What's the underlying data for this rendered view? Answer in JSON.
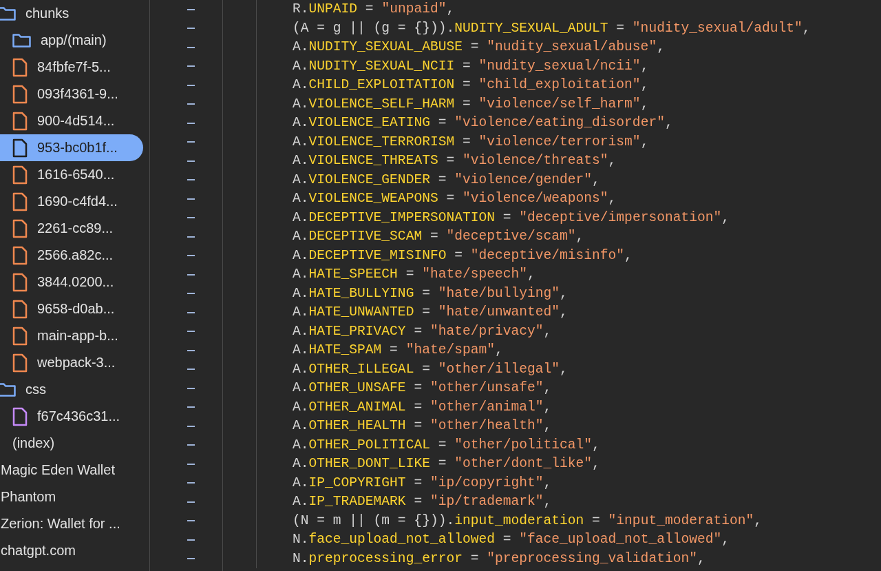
{
  "sidebar": {
    "items": [
      {
        "label": "chunks",
        "kind": "folder",
        "selected": false,
        "children": [
          {
            "label": "app/(main)",
            "kind": "folder",
            "selected": false
          },
          {
            "label": "84fbfe7f-5...",
            "kind": "script",
            "selected": false
          },
          {
            "label": "093f4361-9...",
            "kind": "script",
            "selected": false
          },
          {
            "label": "900-4d514...",
            "kind": "script",
            "selected": false
          },
          {
            "label": "953-bc0b1f...",
            "kind": "script",
            "selected": true
          },
          {
            "label": "1616-6540...",
            "kind": "script",
            "selected": false
          },
          {
            "label": "1690-c4fd4...",
            "kind": "script",
            "selected": false
          },
          {
            "label": "2261-cc89...",
            "kind": "script",
            "selected": false
          },
          {
            "label": "2566.a82c...",
            "kind": "script",
            "selected": false
          },
          {
            "label": "3844.0200...",
            "kind": "script",
            "selected": false
          },
          {
            "label": "9658-d0ab...",
            "kind": "script",
            "selected": false
          },
          {
            "label": "main-app-b...",
            "kind": "script",
            "selected": false
          },
          {
            "label": "webpack-3...",
            "kind": "script",
            "selected": false
          }
        ]
      },
      {
        "label": "css",
        "kind": "folder",
        "selected": false,
        "children": [
          {
            "label": "f67c436c31...",
            "kind": "stylesheet",
            "selected": false
          }
        ]
      },
      {
        "label": "(index)",
        "kind": "document",
        "selected": false
      },
      {
        "label": "Magic Eden Wallet",
        "kind": "frame",
        "selected": false
      },
      {
        "label": "Phantom",
        "kind": "frame",
        "selected": false
      },
      {
        "label": "Zerion: Wallet for ...",
        "kind": "frame",
        "selected": false
      },
      {
        "label": "chatgpt.com",
        "kind": "frame",
        "selected": false
      }
    ]
  },
  "code": {
    "lines": [
      [
        {
          "kind": "plain",
          "text": "R."
        },
        {
          "kind": "prop",
          "text": "UNPAID"
        },
        {
          "kind": "plain",
          "text": " = "
        },
        {
          "kind": "string",
          "text": "\"unpaid\""
        },
        {
          "kind": "plain",
          "text": ","
        }
      ],
      [
        {
          "kind": "plain",
          "text": "(A = g || (g = {}))."
        },
        {
          "kind": "prop",
          "text": "NUDITY_SEXUAL_ADULT"
        },
        {
          "kind": "plain",
          "text": " = "
        },
        {
          "kind": "string",
          "text": "\"nudity_sexual/adult\""
        },
        {
          "kind": "plain",
          "text": ","
        }
      ],
      [
        {
          "kind": "plain",
          "text": "A."
        },
        {
          "kind": "prop",
          "text": "NUDITY_SEXUAL_ABUSE"
        },
        {
          "kind": "plain",
          "text": " = "
        },
        {
          "kind": "string",
          "text": "\"nudity_sexual/abuse\""
        },
        {
          "kind": "plain",
          "text": ","
        }
      ],
      [
        {
          "kind": "plain",
          "text": "A."
        },
        {
          "kind": "prop",
          "text": "NUDITY_SEXUAL_NCII"
        },
        {
          "kind": "plain",
          "text": " = "
        },
        {
          "kind": "string",
          "text": "\"nudity_sexual/ncii\""
        },
        {
          "kind": "plain",
          "text": ","
        }
      ],
      [
        {
          "kind": "plain",
          "text": "A."
        },
        {
          "kind": "prop",
          "text": "CHILD_EXPLOITATION"
        },
        {
          "kind": "plain",
          "text": " = "
        },
        {
          "kind": "string",
          "text": "\"child_exploitation\""
        },
        {
          "kind": "plain",
          "text": ","
        }
      ],
      [
        {
          "kind": "plain",
          "text": "A."
        },
        {
          "kind": "prop",
          "text": "VIOLENCE_SELF_HARM"
        },
        {
          "kind": "plain",
          "text": " = "
        },
        {
          "kind": "string",
          "text": "\"violence/self_harm\""
        },
        {
          "kind": "plain",
          "text": ","
        }
      ],
      [
        {
          "kind": "plain",
          "text": "A."
        },
        {
          "kind": "prop",
          "text": "VIOLENCE_EATING"
        },
        {
          "kind": "plain",
          "text": " = "
        },
        {
          "kind": "string",
          "text": "\"violence/eating_disorder\""
        },
        {
          "kind": "plain",
          "text": ","
        }
      ],
      [
        {
          "kind": "plain",
          "text": "A."
        },
        {
          "kind": "prop",
          "text": "VIOLENCE_TERRORISM"
        },
        {
          "kind": "plain",
          "text": " = "
        },
        {
          "kind": "string",
          "text": "\"violence/terrorism\""
        },
        {
          "kind": "plain",
          "text": ","
        }
      ],
      [
        {
          "kind": "plain",
          "text": "A."
        },
        {
          "kind": "prop",
          "text": "VIOLENCE_THREATS"
        },
        {
          "kind": "plain",
          "text": " = "
        },
        {
          "kind": "string",
          "text": "\"violence/threats\""
        },
        {
          "kind": "plain",
          "text": ","
        }
      ],
      [
        {
          "kind": "plain",
          "text": "A."
        },
        {
          "kind": "prop",
          "text": "VIOLENCE_GENDER"
        },
        {
          "kind": "plain",
          "text": " = "
        },
        {
          "kind": "string",
          "text": "\"violence/gender\""
        },
        {
          "kind": "plain",
          "text": ","
        }
      ],
      [
        {
          "kind": "plain",
          "text": "A."
        },
        {
          "kind": "prop",
          "text": "VIOLENCE_WEAPONS"
        },
        {
          "kind": "plain",
          "text": " = "
        },
        {
          "kind": "string",
          "text": "\"violence/weapons\""
        },
        {
          "kind": "plain",
          "text": ","
        }
      ],
      [
        {
          "kind": "plain",
          "text": "A."
        },
        {
          "kind": "prop",
          "text": "DECEPTIVE_IMPERSONATION"
        },
        {
          "kind": "plain",
          "text": " = "
        },
        {
          "kind": "string",
          "text": "\"deceptive/impersonation\""
        },
        {
          "kind": "plain",
          "text": ","
        }
      ],
      [
        {
          "kind": "plain",
          "text": "A."
        },
        {
          "kind": "prop",
          "text": "DECEPTIVE_SCAM"
        },
        {
          "kind": "plain",
          "text": " = "
        },
        {
          "kind": "string",
          "text": "\"deceptive/scam\""
        },
        {
          "kind": "plain",
          "text": ","
        }
      ],
      [
        {
          "kind": "plain",
          "text": "A."
        },
        {
          "kind": "prop",
          "text": "DECEPTIVE_MISINFO"
        },
        {
          "kind": "plain",
          "text": " = "
        },
        {
          "kind": "string",
          "text": "\"deceptive/misinfo\""
        },
        {
          "kind": "plain",
          "text": ","
        }
      ],
      [
        {
          "kind": "plain",
          "text": "A."
        },
        {
          "kind": "prop",
          "text": "HATE_SPEECH"
        },
        {
          "kind": "plain",
          "text": " = "
        },
        {
          "kind": "string",
          "text": "\"hate/speech\""
        },
        {
          "kind": "plain",
          "text": ","
        }
      ],
      [
        {
          "kind": "plain",
          "text": "A."
        },
        {
          "kind": "prop",
          "text": "HATE_BULLYING"
        },
        {
          "kind": "plain",
          "text": " = "
        },
        {
          "kind": "string",
          "text": "\"hate/bullying\""
        },
        {
          "kind": "plain",
          "text": ","
        }
      ],
      [
        {
          "kind": "plain",
          "text": "A."
        },
        {
          "kind": "prop",
          "text": "HATE_UNWANTED"
        },
        {
          "kind": "plain",
          "text": " = "
        },
        {
          "kind": "string",
          "text": "\"hate/unwanted\""
        },
        {
          "kind": "plain",
          "text": ","
        }
      ],
      [
        {
          "kind": "plain",
          "text": "A."
        },
        {
          "kind": "prop",
          "text": "HATE_PRIVACY"
        },
        {
          "kind": "plain",
          "text": " = "
        },
        {
          "kind": "string",
          "text": "\"hate/privacy\""
        },
        {
          "kind": "plain",
          "text": ","
        }
      ],
      [
        {
          "kind": "plain",
          "text": "A."
        },
        {
          "kind": "prop",
          "text": "HATE_SPAM"
        },
        {
          "kind": "plain",
          "text": " = "
        },
        {
          "kind": "string",
          "text": "\"hate/spam\""
        },
        {
          "kind": "plain",
          "text": ","
        }
      ],
      [
        {
          "kind": "plain",
          "text": "A."
        },
        {
          "kind": "prop",
          "text": "OTHER_ILLEGAL"
        },
        {
          "kind": "plain",
          "text": " = "
        },
        {
          "kind": "string",
          "text": "\"other/illegal\""
        },
        {
          "kind": "plain",
          "text": ","
        }
      ],
      [
        {
          "kind": "plain",
          "text": "A."
        },
        {
          "kind": "prop",
          "text": "OTHER_UNSAFE"
        },
        {
          "kind": "plain",
          "text": " = "
        },
        {
          "kind": "string",
          "text": "\"other/unsafe\""
        },
        {
          "kind": "plain",
          "text": ","
        }
      ],
      [
        {
          "kind": "plain",
          "text": "A."
        },
        {
          "kind": "prop",
          "text": "OTHER_ANIMAL"
        },
        {
          "kind": "plain",
          "text": " = "
        },
        {
          "kind": "string",
          "text": "\"other/animal\""
        },
        {
          "kind": "plain",
          "text": ","
        }
      ],
      [
        {
          "kind": "plain",
          "text": "A."
        },
        {
          "kind": "prop",
          "text": "OTHER_HEALTH"
        },
        {
          "kind": "plain",
          "text": " = "
        },
        {
          "kind": "string",
          "text": "\"other/health\""
        },
        {
          "kind": "plain",
          "text": ","
        }
      ],
      [
        {
          "kind": "plain",
          "text": "A."
        },
        {
          "kind": "prop",
          "text": "OTHER_POLITICAL"
        },
        {
          "kind": "plain",
          "text": " = "
        },
        {
          "kind": "string",
          "text": "\"other/political\""
        },
        {
          "kind": "plain",
          "text": ","
        }
      ],
      [
        {
          "kind": "plain",
          "text": "A."
        },
        {
          "kind": "prop",
          "text": "OTHER_DONT_LIKE"
        },
        {
          "kind": "plain",
          "text": " = "
        },
        {
          "kind": "string",
          "text": "\"other/dont_like\""
        },
        {
          "kind": "plain",
          "text": ","
        }
      ],
      [
        {
          "kind": "plain",
          "text": "A."
        },
        {
          "kind": "prop",
          "text": "IP_COPYRIGHT"
        },
        {
          "kind": "plain",
          "text": " = "
        },
        {
          "kind": "string",
          "text": "\"ip/copyright\""
        },
        {
          "kind": "plain",
          "text": ","
        }
      ],
      [
        {
          "kind": "plain",
          "text": "A."
        },
        {
          "kind": "prop",
          "text": "IP_TRADEMARK"
        },
        {
          "kind": "plain",
          "text": " = "
        },
        {
          "kind": "string",
          "text": "\"ip/trademark\""
        },
        {
          "kind": "plain",
          "text": ","
        }
      ],
      [
        {
          "kind": "plain",
          "text": "(N = m || (m = {}))."
        },
        {
          "kind": "prop",
          "text": "input_moderation"
        },
        {
          "kind": "plain",
          "text": " = "
        },
        {
          "kind": "string",
          "text": "\"input_moderation\""
        },
        {
          "kind": "plain",
          "text": ","
        }
      ],
      [
        {
          "kind": "plain",
          "text": "N."
        },
        {
          "kind": "prop",
          "text": "face_upload_not_allowed"
        },
        {
          "kind": "plain",
          "text": " = "
        },
        {
          "kind": "string",
          "text": "\"face_upload_not_allowed\""
        },
        {
          "kind": "plain",
          "text": ","
        }
      ],
      [
        {
          "kind": "plain",
          "text": "N."
        },
        {
          "kind": "prop",
          "text": "preprocessing_error"
        },
        {
          "kind": "plain",
          "text": " = "
        },
        {
          "kind": "string",
          "text": "\"preprocessing_validation\""
        },
        {
          "kind": "plain",
          "text": ","
        }
      ]
    ]
  }
}
